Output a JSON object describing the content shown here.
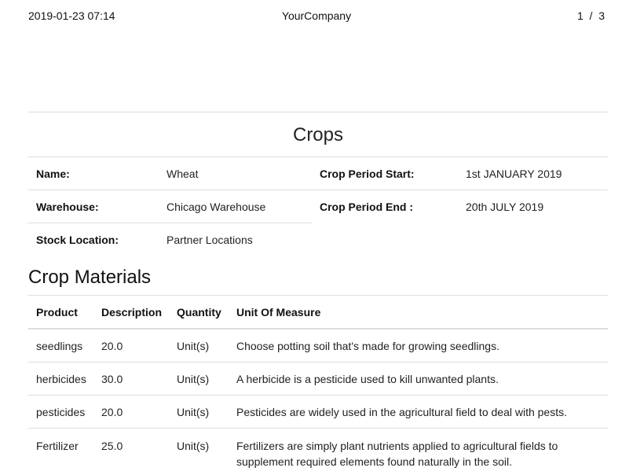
{
  "header": {
    "datetime": "2019-01-23 07:14",
    "company": "YourCompany",
    "page_current": "1",
    "page_sep": "/",
    "page_total": "3"
  },
  "title": "Crops",
  "info": {
    "name_label": "Name:",
    "name_value": "Wheat",
    "warehouse_label": "Warehouse:",
    "warehouse_value": "Chicago Warehouse",
    "stock_location_label": "Stock Location:",
    "stock_location_value": "Partner Locations",
    "period_start_label": "Crop Period Start:",
    "period_start_value": "1st JANUARY 2019",
    "period_end_label": "Crop Period End :",
    "period_end_value": "20th JULY 2019"
  },
  "materials": {
    "title": "Crop Materials",
    "columns": [
      "Product",
      "Description",
      "Quantity",
      "Unit Of Measure"
    ],
    "rows": [
      [
        "seedlings",
        "20.0",
        "Unit(s)",
        "Choose potting soil that's made for growing seedlings."
      ],
      [
        "herbicides",
        "30.0",
        "Unit(s)",
        "A herbicide is a pesticide used to kill unwanted plants."
      ],
      [
        "pesticides",
        "20.0",
        "Unit(s)",
        "Pesticides are widely used in the agricultural field to deal with pests."
      ],
      [
        "Fertilizer",
        "25.0",
        "Unit(s)",
        "Fertilizers are simply plant nutrients applied to agricultural fields to supplement required elements found naturally in the soil."
      ]
    ]
  }
}
